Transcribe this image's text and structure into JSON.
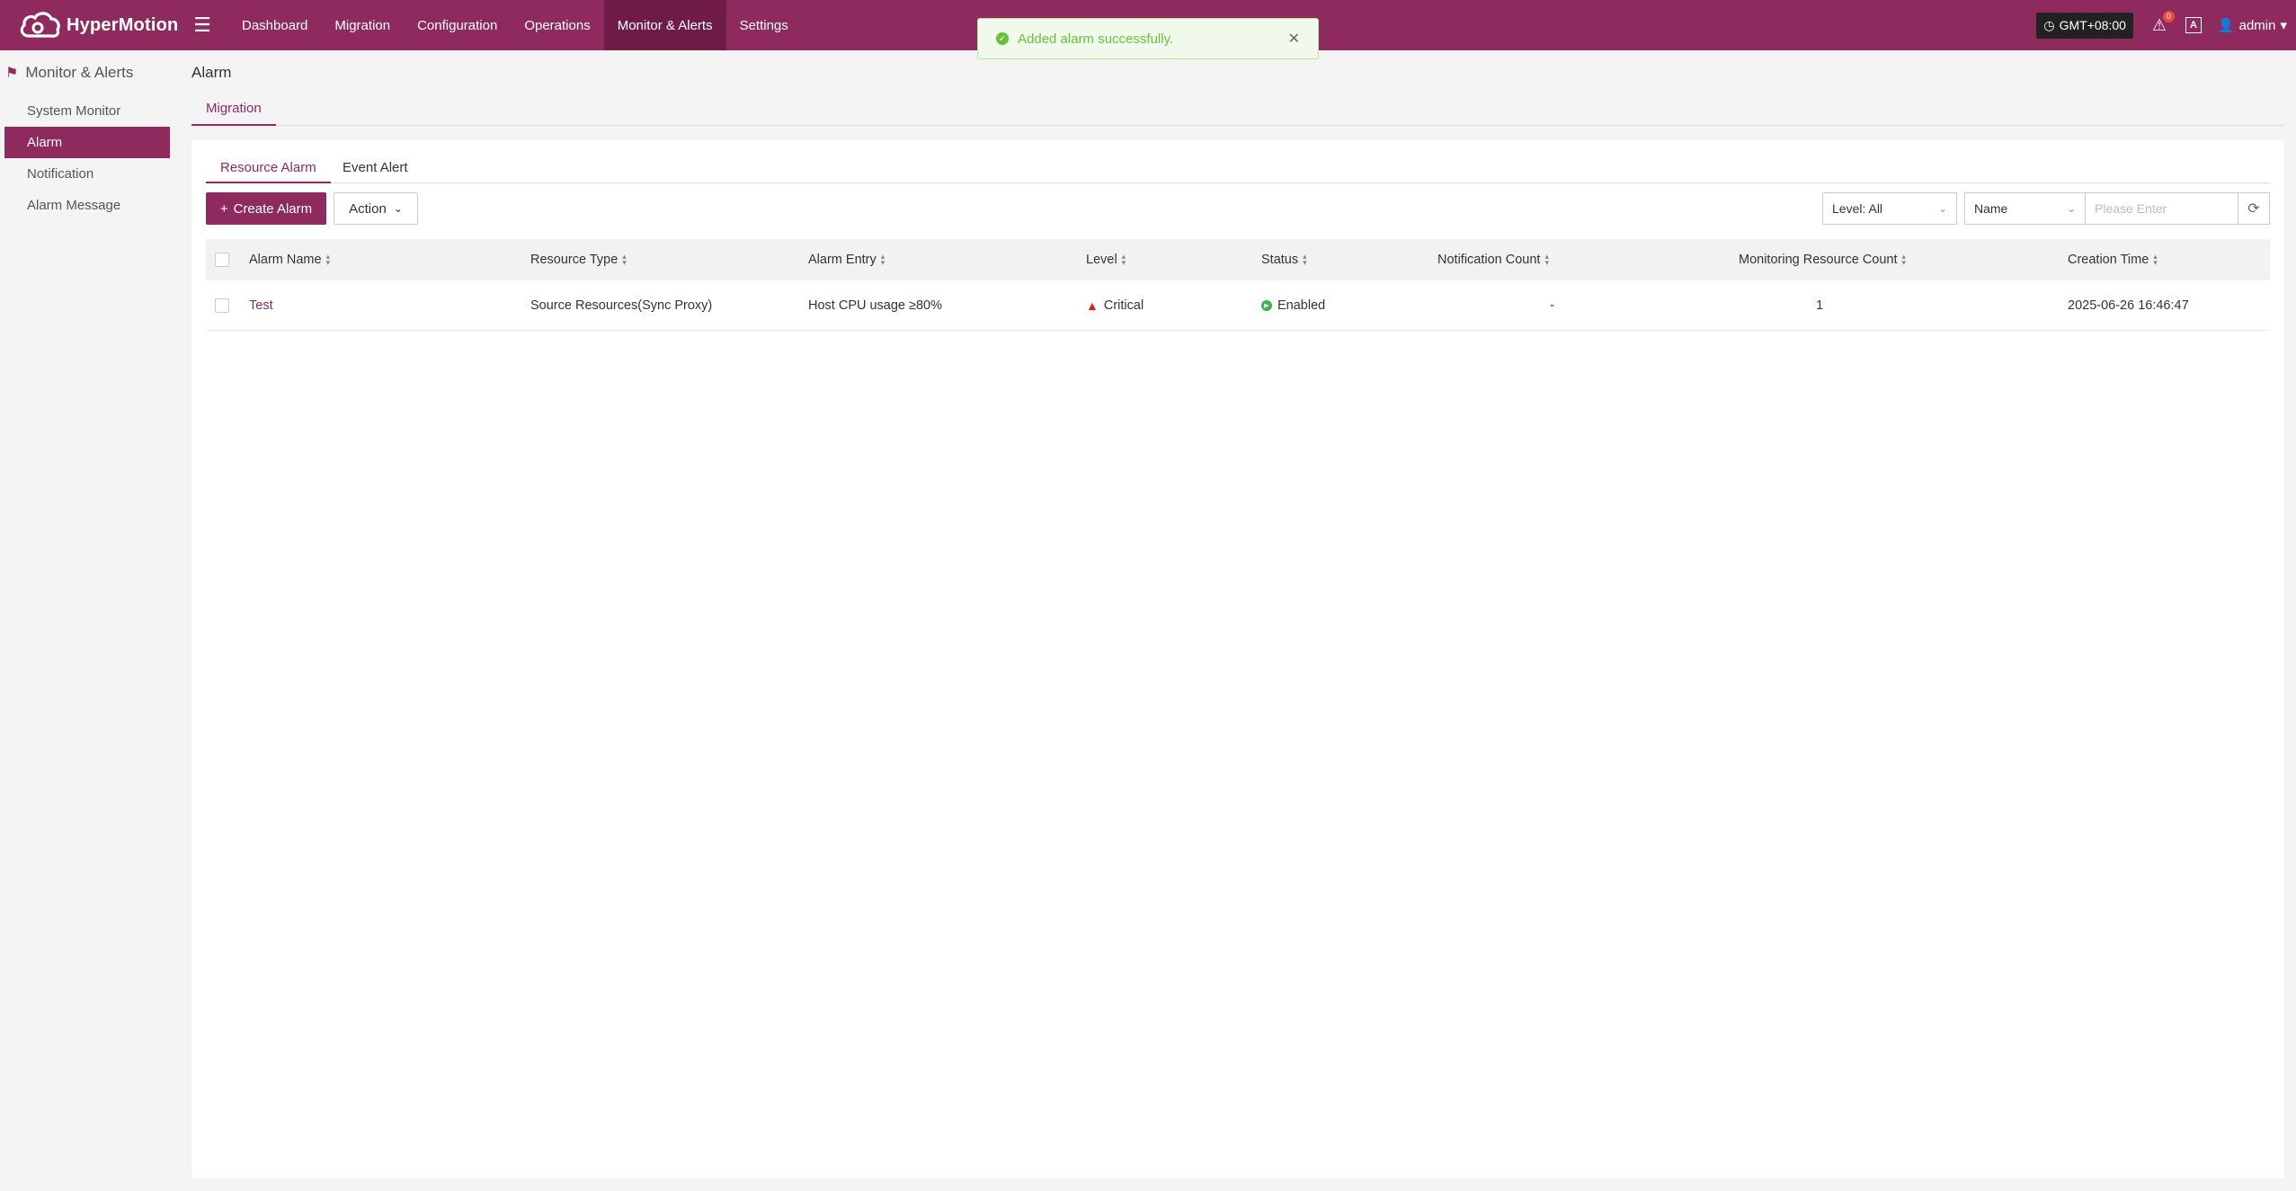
{
  "app": {
    "name": "HyperMotion"
  },
  "nav": {
    "items": [
      {
        "label": "Dashboard"
      },
      {
        "label": "Migration"
      },
      {
        "label": "Configuration"
      },
      {
        "label": "Operations"
      },
      {
        "label": "Monitor & Alerts",
        "active": true
      },
      {
        "label": "Settings"
      }
    ]
  },
  "topright": {
    "timezone": "GMT+08:00",
    "alert_badge": "0",
    "lang_icon": "A",
    "user": "admin"
  },
  "toast": {
    "message": "Added alarm successfully."
  },
  "sidebar": {
    "header": "Monitor & Alerts",
    "items": [
      {
        "label": "System Monitor"
      },
      {
        "label": "Alarm",
        "active": true
      },
      {
        "label": "Notification"
      },
      {
        "label": "Alarm Message"
      }
    ]
  },
  "page": {
    "title": "Alarm",
    "subtab": "Migration"
  },
  "tabs": [
    {
      "label": "Resource Alarm",
      "active": true
    },
    {
      "label": "Event Alert"
    }
  ],
  "toolbar": {
    "create_label": "Create Alarm",
    "action_label": "Action",
    "level_filter": "Level: All",
    "search_field": "Name",
    "search_placeholder": "Please Enter"
  },
  "table": {
    "columns": [
      "Alarm Name",
      "Resource Type",
      "Alarm Entry",
      "Level",
      "Status",
      "Notification Count",
      "Monitoring Resource Count",
      "Creation Time"
    ],
    "rows": [
      {
        "name": "Test",
        "resource_type": "Source Resources(Sync Proxy)",
        "entry": "Host CPU usage ≥80%",
        "level": "Critical",
        "status": "Enabled",
        "notification_count": "-",
        "monitoring_count": "1",
        "created": "2025-06-26 16:46:47"
      }
    ]
  },
  "colors": {
    "brand": "#8e2a5e",
    "brand_dark": "#6e1c47",
    "success": "#67c23a",
    "critical": "#d9231c"
  }
}
